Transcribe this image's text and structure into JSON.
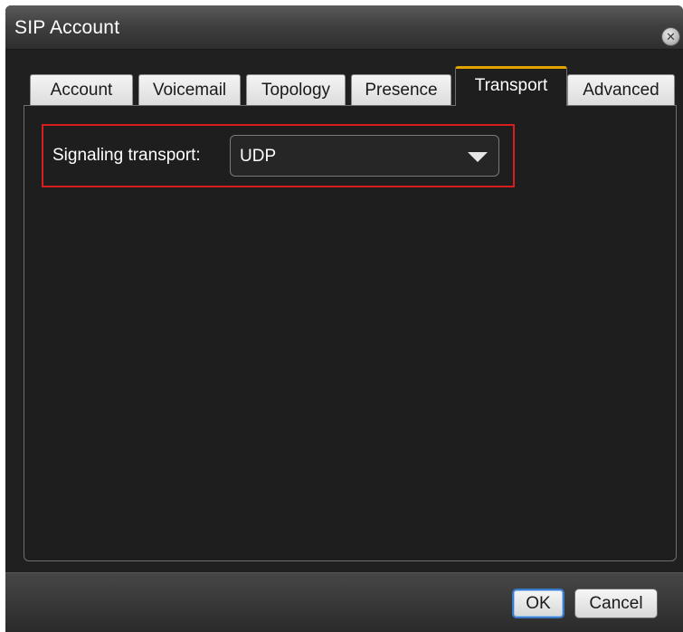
{
  "window": {
    "title": "SIP Account",
    "close_icon": "close-icon"
  },
  "tabs": [
    {
      "label": "Account",
      "active": false
    },
    {
      "label": "Voicemail",
      "active": false
    },
    {
      "label": "Topology",
      "active": false
    },
    {
      "label": "Presence",
      "active": false
    },
    {
      "label": "Transport",
      "active": true
    },
    {
      "label": "Advanced",
      "active": false
    }
  ],
  "transport": {
    "signaling_label": "Signaling transport:",
    "signaling_value": "UDP",
    "dropdown_icon": "chevron-down-icon"
  },
  "footer": {
    "ok_label": "OK",
    "cancel_label": "Cancel"
  },
  "colors": {
    "highlight": "#d81e1e",
    "active_tab_accent": "#e2a200",
    "primary_button_border": "#3b7ac8"
  }
}
